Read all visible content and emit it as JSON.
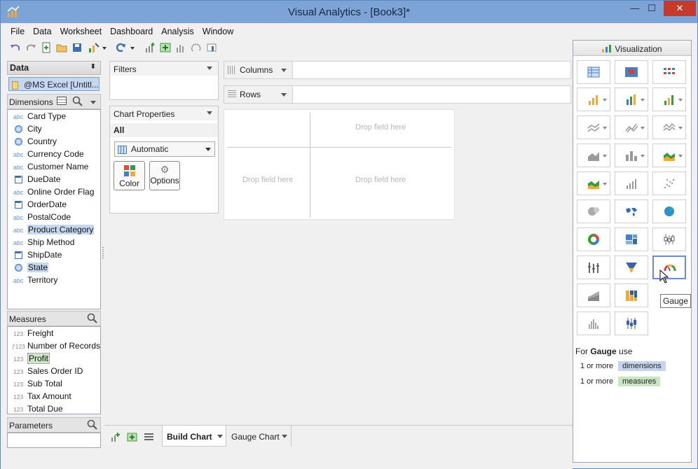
{
  "window": {
    "title": "Visual Analytics - [Book3]*",
    "minimize": "—",
    "maximize": "☐",
    "close": "✕"
  },
  "menu": [
    "File",
    "Data",
    "Worksheet",
    "Dashboard",
    "Analysis",
    "Window"
  ],
  "data_panel": {
    "header": "Data",
    "source": "@MS Excel [Untitl...",
    "dimensions_label": "Dimensions",
    "dimensions": [
      {
        "icon": "abc",
        "label": "Card Type"
      },
      {
        "icon": "globe",
        "label": "City"
      },
      {
        "icon": "globe",
        "label": "Country"
      },
      {
        "icon": "abc",
        "label": "Currency Code"
      },
      {
        "icon": "abc",
        "label": "Customer Name"
      },
      {
        "icon": "date",
        "label": "DueDate"
      },
      {
        "icon": "abc",
        "label": "Online Order Flag"
      },
      {
        "icon": "date",
        "label": "OrderDate"
      },
      {
        "icon": "abc",
        "label": "PostalCode"
      },
      {
        "icon": "abc",
        "label": "Product Category"
      },
      {
        "icon": "abc",
        "label": "Ship Method"
      },
      {
        "icon": "date",
        "label": "ShipDate"
      },
      {
        "icon": "globe",
        "label": "State"
      },
      {
        "icon": "abc",
        "label": "Territory"
      }
    ],
    "measures_label": "Measures",
    "measures": [
      {
        "icon": "123",
        "label": "Freight"
      },
      {
        "icon": "f123",
        "label": "Number of Records"
      },
      {
        "icon": "123",
        "label": "Profit"
      },
      {
        "icon": "123",
        "label": "Sales Order ID"
      },
      {
        "icon": "123",
        "label": "Sub Total"
      },
      {
        "icon": "123",
        "label": "Tax Amount"
      },
      {
        "icon": "123",
        "label": "Total Due"
      }
    ],
    "parameters_label": "Parameters"
  },
  "filters": {
    "header": "Filters"
  },
  "chart_properties": {
    "header": "Chart Properties",
    "scope": "All",
    "mark_type": "Automatic",
    "color_label": "Color",
    "options_label": "Options"
  },
  "shelves": {
    "columns": "Columns",
    "rows": "Rows"
  },
  "canvas": {
    "drop_top": "Drop field here",
    "drop_left": "Drop field here",
    "drop_center": "Drop field here"
  },
  "tabs": [
    {
      "label": "Build Chart",
      "active": true
    },
    {
      "label": "Gauge Chart",
      "active": false
    }
  ],
  "visualization": {
    "header": "Visualization",
    "tooltip": "Gauge",
    "for_prefix": "For",
    "for_chart": "Gauge",
    "for_suffix": "use",
    "req_dim_count": "1 or more",
    "req_dim_label": "dimensions",
    "req_meas_count": "1 or more",
    "req_meas_label": "measures"
  },
  "colors": {
    "titlebar": "#7ea3d6",
    "selection": "#c6d8f1",
    "measure_pill": "#c8e6c1",
    "dimension_pill": "#c5d5f0",
    "close": "#c7392b"
  }
}
